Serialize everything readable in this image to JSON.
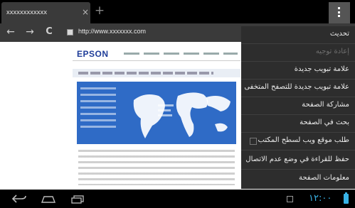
{
  "tab": {
    "title": "xxxxxxxxxxxx",
    "close_glyph": "×",
    "newtab_glyph": "+"
  },
  "toolbar": {
    "back_glyph": "←",
    "forward_glyph": "→",
    "reload_glyph": "C",
    "url": "http://www.xxxxxxx.com"
  },
  "webpage": {
    "logo": "EPSON"
  },
  "menu": {
    "items": [
      {
        "label": "تحديث",
        "enabled": true
      },
      {
        "label": "إعادة توجيه",
        "enabled": false
      },
      {
        "label": "علامة تبويب جديدة",
        "enabled": true
      },
      {
        "label": "علامة تبويب جديدة للتصفح المتخفى",
        "enabled": true
      },
      {
        "label": "مشاركة الصفحة",
        "enabled": true
      },
      {
        "label": "بحث في الصفحة",
        "enabled": true
      },
      {
        "label": "طلب موقع ويب لسطح المكتب",
        "enabled": true,
        "checkbox": false
      },
      {
        "label": "حفظ للقراءة في وضع عدم الاتصال",
        "enabled": true
      },
      {
        "label": "معلومات الصفحة",
        "enabled": true
      }
    ]
  },
  "system": {
    "clock": "١٢:٠٠",
    "icons": [
      "back-icon",
      "home-icon",
      "recent-apps-icon",
      "notification-icon",
      "battery-icon"
    ],
    "accent_color": "#39b3e6"
  }
}
